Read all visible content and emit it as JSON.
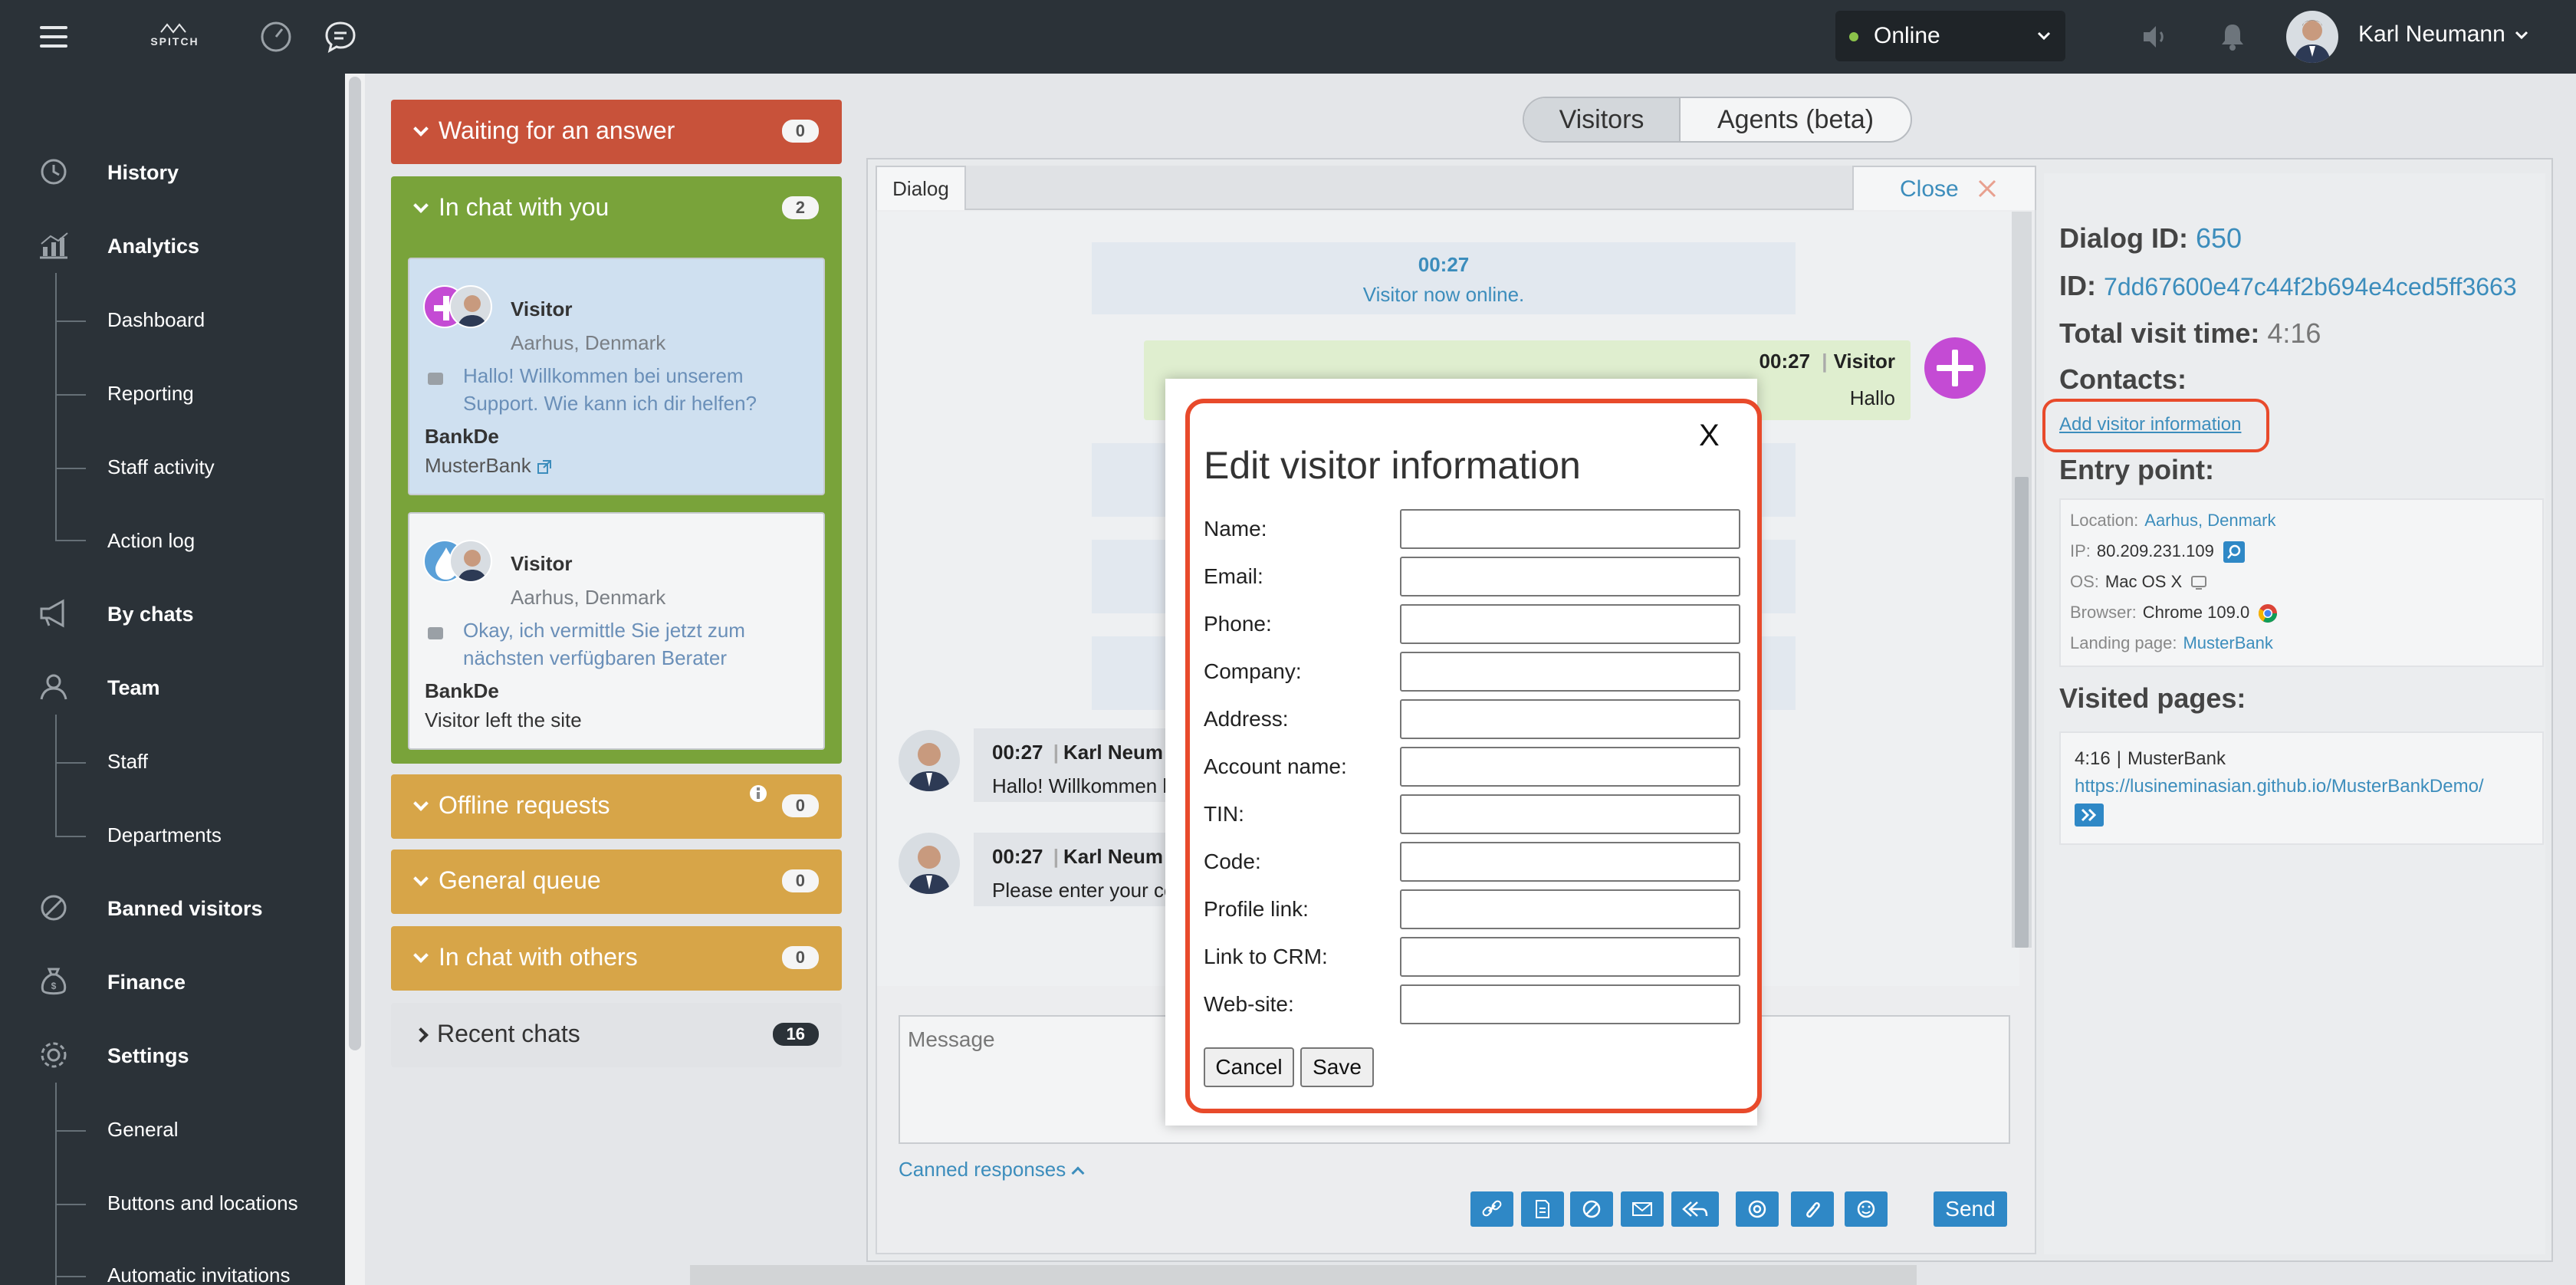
{
  "topbar": {
    "logo": "SPITCH",
    "status": "Online",
    "user_name": "Karl Neumann"
  },
  "sidebar": {
    "history": "History",
    "analytics": "Analytics",
    "dashboard": "Dashboard",
    "reporting": "Reporting",
    "staff_activity": "Staff activity",
    "action_log": "Action log",
    "by_chats": "By chats",
    "team": "Team",
    "staff": "Staff",
    "departments": "Departments",
    "banned_visitors": "Banned visitors",
    "finance": "Finance",
    "settings": "Settings",
    "general": "General",
    "buttons_locations": "Buttons and locations",
    "automatic_invitations": "Automatic invitations"
  },
  "queues": {
    "waiting": {
      "label": "Waiting for an answer",
      "count": "0"
    },
    "in_chat_you": {
      "label": "In chat with you",
      "count": "2"
    },
    "offline": {
      "label": "Offline requests",
      "count": "0"
    },
    "general_queue": {
      "label": "General queue",
      "count": "0"
    },
    "in_chat_others": {
      "label": "In chat with others",
      "count": "0"
    },
    "recent": {
      "label": "Recent chats",
      "count": "16"
    }
  },
  "chats": [
    {
      "title": "Visitor",
      "location": "Aarhus, Denmark",
      "message": "Hallo! Willkommen bei unserem Support. Wie kann ich dir helfen?",
      "department": "BankDe",
      "sub": "MusterBank"
    },
    {
      "title": "Visitor",
      "location": "Aarhus, Denmark",
      "message": "Okay, ich vermittle Sie jetzt zum nächsten verfügbaren Berater",
      "department": "BankDe",
      "sub": "Visitor left the site"
    }
  ],
  "main_tabs": {
    "visitors": "Visitors",
    "agents": "Agents (beta)"
  },
  "dialog": {
    "tab": "Dialog",
    "close": "Close",
    "sys_time": "00:27",
    "sys_msg": "Visitor now online.",
    "visitor_time": "00:27",
    "visitor_name": "Visitor",
    "visitor_msg": "Hallo",
    "agent_msgs": [
      {
        "time": "00:27",
        "name": "Karl Neum",
        "text": "Hallo! Willkommen b"
      },
      {
        "time": "00:27",
        "name": "Karl Neum",
        "text": "Please enter your co"
      }
    ],
    "message_placeholder": "Message",
    "canned": "Canned responses",
    "send": "Send"
  },
  "info": {
    "dialog_id_label": "Dialog ID:",
    "dialog_id": "650",
    "id_label": "ID:",
    "id": "7dd67600e47c44f2b694e4ced5ff3663",
    "visit_time_label": "Total visit time:",
    "visit_time": "4:16",
    "contacts_label": "Contacts:",
    "add_visitor_info": "Add visitor information",
    "entry_label": "Entry point:",
    "location_k": "Location:",
    "location_v": "Aarhus, Denmark",
    "ip_k": "IP:",
    "ip_v": "80.209.231.109",
    "os_k": "OS:",
    "os_v": "Mac OS X",
    "browser_k": "Browser:",
    "browser_v": "Chrome 109.0",
    "landing_k": "Landing page:",
    "landing_v": "MusterBank",
    "visited_label": "Visited pages:",
    "visited_time": "4:16",
    "visited_title": "MusterBank",
    "visited_url": "https://lusineminasian.github.io/MusterBankDemo/"
  },
  "modal": {
    "title": "Edit visitor information",
    "close": "X",
    "fields": {
      "name": "Name:",
      "email": "Email:",
      "phone": "Phone:",
      "company": "Company:",
      "address": "Address:",
      "account": "Account name:",
      "tin": "TIN:",
      "code": "Code:",
      "profile": "Profile link:",
      "crm": "Link to CRM:",
      "website": "Web-site:"
    },
    "cancel": "Cancel",
    "save": "Save"
  },
  "colors": {
    "sidebar": "#2b3238",
    "waiting": "#c8523a",
    "in_chat": "#79a33a",
    "queue": "#d7a548",
    "accent": "#3c8dbc",
    "highlight_ring": "#e84a2b"
  }
}
